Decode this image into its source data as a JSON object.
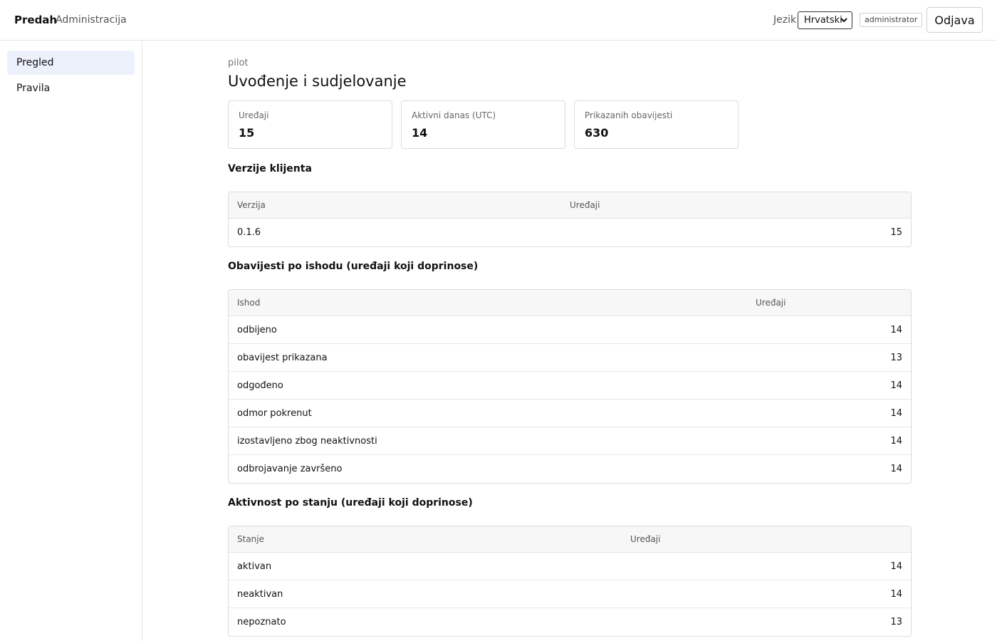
{
  "header": {
    "brand": "Predah",
    "subtitle": "Administracija",
    "language_label": "Jezik",
    "language_selected": "Hrvatski",
    "role": "administrator",
    "logout_label": "Odjava"
  },
  "sidebar": {
    "items": [
      {
        "label": "Pregled",
        "active": true
      },
      {
        "label": "Pravila",
        "active": false
      }
    ]
  },
  "main": {
    "eyebrow": "pilot",
    "title": "Uvođenje i sudjelovanje",
    "stats": [
      {
        "label": "Uređaji",
        "value": "15"
      },
      {
        "label": "Aktivni danas (UTC)",
        "value": "14"
      },
      {
        "label": "Prikazanih obavijesti",
        "value": "630"
      }
    ],
    "versions": {
      "title": "Verzije klijenta",
      "columns": [
        "Verzija",
        "Uređaji"
      ],
      "rows": [
        {
          "name": "0.1.6",
          "count": "15"
        }
      ]
    },
    "outcomes": {
      "title": "Obavijesti po ishodu (uređaji koji doprinose)",
      "columns": [
        "Ishod",
        "Uređaji"
      ],
      "rows": [
        {
          "name": "odbijeno",
          "count": "14"
        },
        {
          "name": "obavijest prikazana",
          "count": "13"
        },
        {
          "name": "odgođeno",
          "count": "14"
        },
        {
          "name": "odmor pokrenut",
          "count": "14"
        },
        {
          "name": "izostavljeno zbog neaktivnosti",
          "count": "14"
        },
        {
          "name": "odbrojavanje završeno",
          "count": "14"
        }
      ]
    },
    "states": {
      "title": "Aktivnost po stanju (uređaji koji doprinose)",
      "columns": [
        "Stanje",
        "Uređaji"
      ],
      "rows": [
        {
          "name": "aktivan",
          "count": "14"
        },
        {
          "name": "neaktivan",
          "count": "14"
        },
        {
          "name": "nepoznato",
          "count": "13"
        }
      ]
    }
  },
  "colors": {
    "accent_active_bg": "#edf1fb",
    "border": "#dcdcdc",
    "table_header_bg": "#f7f7f7"
  }
}
